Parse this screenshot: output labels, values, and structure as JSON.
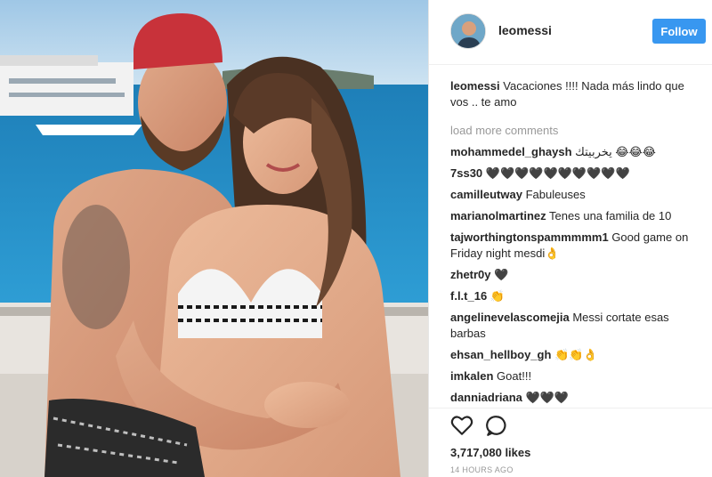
{
  "post": {
    "username": "leomessi",
    "follow_label": "Follow",
    "caption": {
      "user": "leomessi",
      "text": "Vacaciones !!!! Nada más lindo que vos .. te amo"
    },
    "load_more": "load more comments",
    "comments": [
      {
        "user": "mohammedel_ghaysh",
        "text": "يخربيتك 😂😂😂"
      },
      {
        "user": "7ss30",
        "text": "🖤🖤🖤🖤🖤🖤🖤🖤🖤🖤"
      },
      {
        "user": "camilleutway",
        "text": "Fabuleuses"
      },
      {
        "user": "marianolmartinez",
        "text": "Tenes una familia de 10"
      },
      {
        "user": "tajworthingtonspammmmm1",
        "text": "Good game on Friday night mesdi👌"
      },
      {
        "user": "zhetr0y",
        "text": "🖤"
      },
      {
        "user": "f.l.t_16",
        "text": "👏"
      },
      {
        "user": "angelinevelascomejia",
        "text": "Messi cortate esas barbas"
      },
      {
        "user": "ehsan_hellboy_gh",
        "text": "👏👏👌"
      },
      {
        "user": "imkalen",
        "text": "Goat!!!"
      },
      {
        "user": "dannia­driana",
        "text": "🖤🖤🖤"
      }
    ],
    "likes": "3,717,080 likes",
    "timestamp": "14 HOURS AGO",
    "accent_color": "#3897f0"
  }
}
